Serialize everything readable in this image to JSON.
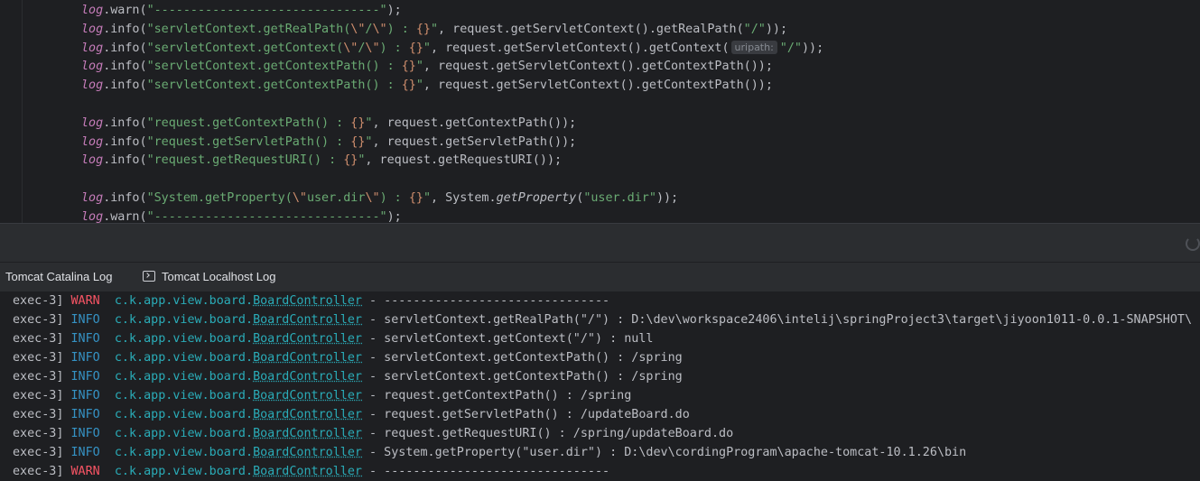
{
  "editor": {
    "lines": [
      {
        "parts": [
          [
            "kw-log",
            "log"
          ],
          [
            "",
            "."
          ],
          [
            "",
            "warn("
          ],
          [
            "str",
            "\"-------------------------------\""
          ],
          [
            "",
            ");"
          ]
        ]
      },
      {
        "parts": [
          [
            "kw-log",
            "log"
          ],
          [
            "",
            "."
          ],
          [
            "",
            "info("
          ],
          [
            "str",
            "\"servletContext.getRealPath("
          ],
          [
            "esc",
            "\\\""
          ],
          [
            "str",
            "/"
          ],
          [
            "esc",
            "\\\""
          ],
          [
            "str",
            ") : "
          ],
          [
            "brace",
            "{}"
          ],
          [
            "str",
            "\""
          ],
          [
            "",
            ", request.getServletContext().getRealPath("
          ],
          [
            "str",
            "\"/\""
          ],
          [
            "",
            "));"
          ]
        ]
      },
      {
        "parts": [
          [
            "kw-log",
            "log"
          ],
          [
            "",
            "."
          ],
          [
            "",
            "info("
          ],
          [
            "str",
            "\"servletContext.getContext("
          ],
          [
            "esc",
            "\\\""
          ],
          [
            "str",
            "/"
          ],
          [
            "esc",
            "\\\""
          ],
          [
            "str",
            ") : "
          ],
          [
            "brace",
            "{}"
          ],
          [
            "str",
            "\""
          ],
          [
            "",
            ", request.getServletContext().getContext("
          ],
          [
            "hint",
            "uripath:"
          ],
          [
            "str",
            "\"/\""
          ],
          [
            "",
            "));"
          ]
        ]
      },
      {
        "parts": [
          [
            "kw-log",
            "log"
          ],
          [
            "",
            "."
          ],
          [
            "",
            "info("
          ],
          [
            "str",
            "\"servletContext.getContextPath() : "
          ],
          [
            "brace",
            "{}"
          ],
          [
            "str",
            "\""
          ],
          [
            "",
            ", request.getServletContext().getContextPath());"
          ]
        ]
      },
      {
        "parts": [
          [
            "kw-log",
            "log"
          ],
          [
            "",
            "."
          ],
          [
            "",
            "info("
          ],
          [
            "str",
            "\"servletContext.getContextPath() : "
          ],
          [
            "brace",
            "{}"
          ],
          [
            "str",
            "\""
          ],
          [
            "",
            ", request.getServletContext().getContextPath());"
          ]
        ]
      },
      {
        "parts": []
      },
      {
        "parts": [
          [
            "kw-log",
            "log"
          ],
          [
            "",
            "."
          ],
          [
            "",
            "info("
          ],
          [
            "str",
            "\"request.getContextPath() : "
          ],
          [
            "brace",
            "{}"
          ],
          [
            "str",
            "\""
          ],
          [
            "",
            ", request.getContextPath());"
          ]
        ]
      },
      {
        "parts": [
          [
            "kw-log",
            "log"
          ],
          [
            "",
            "."
          ],
          [
            "",
            "info("
          ],
          [
            "str",
            "\"request.getServletPath() : "
          ],
          [
            "brace",
            "{}"
          ],
          [
            "str",
            "\""
          ],
          [
            "",
            ", request.getServletPath());"
          ]
        ]
      },
      {
        "parts": [
          [
            "kw-log",
            "log"
          ],
          [
            "",
            "."
          ],
          [
            "",
            "info("
          ],
          [
            "str",
            "\"request.getRequestURI() : "
          ],
          [
            "brace",
            "{}"
          ],
          [
            "str",
            "\""
          ],
          [
            "",
            ", request.getRequestURI());"
          ]
        ]
      },
      {
        "parts": []
      },
      {
        "parts": [
          [
            "kw-log",
            "log"
          ],
          [
            "",
            "."
          ],
          [
            "",
            "info("
          ],
          [
            "str",
            "\"System.getProperty("
          ],
          [
            "esc",
            "\\\""
          ],
          [
            "str",
            "user.dir"
          ],
          [
            "esc",
            "\\\""
          ],
          [
            "str",
            ") : "
          ],
          [
            "brace",
            "{}"
          ],
          [
            "str",
            "\""
          ],
          [
            "",
            ", System."
          ],
          [
            "ital",
            "getProperty"
          ],
          [
            "",
            "("
          ],
          [
            "str",
            "\"user.dir\""
          ],
          [
            "",
            "));"
          ]
        ]
      },
      {
        "parts": [
          [
            "kw-log",
            "log"
          ],
          [
            "",
            "."
          ],
          [
            "",
            "warn("
          ],
          [
            "str",
            "\"-------------------------------\""
          ],
          [
            "",
            ");"
          ]
        ]
      }
    ]
  },
  "tabs": {
    "catalina": "Tomcat Catalina Log",
    "localhost": "Tomcat Localhost Log"
  },
  "console": {
    "lines": [
      {
        "thread": "exec-3]",
        "level": "WARN",
        "pkg": "c.k.app.view.board.",
        "cls": "BoardController",
        "msg": " - -------------------------------"
      },
      {
        "thread": "exec-3]",
        "level": "INFO",
        "pkg": "c.k.app.view.board.",
        "cls": "BoardController",
        "msg": " - servletContext.getRealPath(\"/\") : D:\\dev\\workspace2406\\intelij\\springProject3\\target\\jiyoon1011-0.0.1-SNAPSHOT\\"
      },
      {
        "thread": "exec-3]",
        "level": "INFO",
        "pkg": "c.k.app.view.board.",
        "cls": "BoardController",
        "msg": " - servletContext.getContext(\"/\") : null"
      },
      {
        "thread": "exec-3]",
        "level": "INFO",
        "pkg": "c.k.app.view.board.",
        "cls": "BoardController",
        "msg": " - servletContext.getContextPath() : /spring"
      },
      {
        "thread": "exec-3]",
        "level": "INFO",
        "pkg": "c.k.app.view.board.",
        "cls": "BoardController",
        "msg": " - servletContext.getContextPath() : /spring"
      },
      {
        "thread": "exec-3]",
        "level": "INFO",
        "pkg": "c.k.app.view.board.",
        "cls": "BoardController",
        "msg": " - request.getContextPath() : /spring"
      },
      {
        "thread": "exec-3]",
        "level": "INFO",
        "pkg": "c.k.app.view.board.",
        "cls": "BoardController",
        "msg": " - request.getServletPath() : /updateBoard.do"
      },
      {
        "thread": "exec-3]",
        "level": "INFO",
        "pkg": "c.k.app.view.board.",
        "cls": "BoardController",
        "msg": " - request.getRequestURI() : /spring/updateBoard.do"
      },
      {
        "thread": "exec-3]",
        "level": "INFO",
        "pkg": "c.k.app.view.board.",
        "cls": "BoardController",
        "msg": " - System.getProperty(\"user.dir\") : D:\\dev\\cordingProgram\\apache-tomcat-10.1.26\\bin"
      },
      {
        "thread": "exec-3]",
        "level": "WARN",
        "pkg": "c.k.app.view.board.",
        "cls": "BoardController",
        "msg": " - -------------------------------"
      }
    ]
  },
  "colors": {
    "background": "#1e1f22",
    "warn": "#f75464",
    "info": "#3592c4",
    "string": "#6aab73",
    "class_link": "#2aacb8"
  },
  "icons": {
    "localhost_tab": "terminal-icon",
    "band": "refresh-spinner-icon"
  }
}
